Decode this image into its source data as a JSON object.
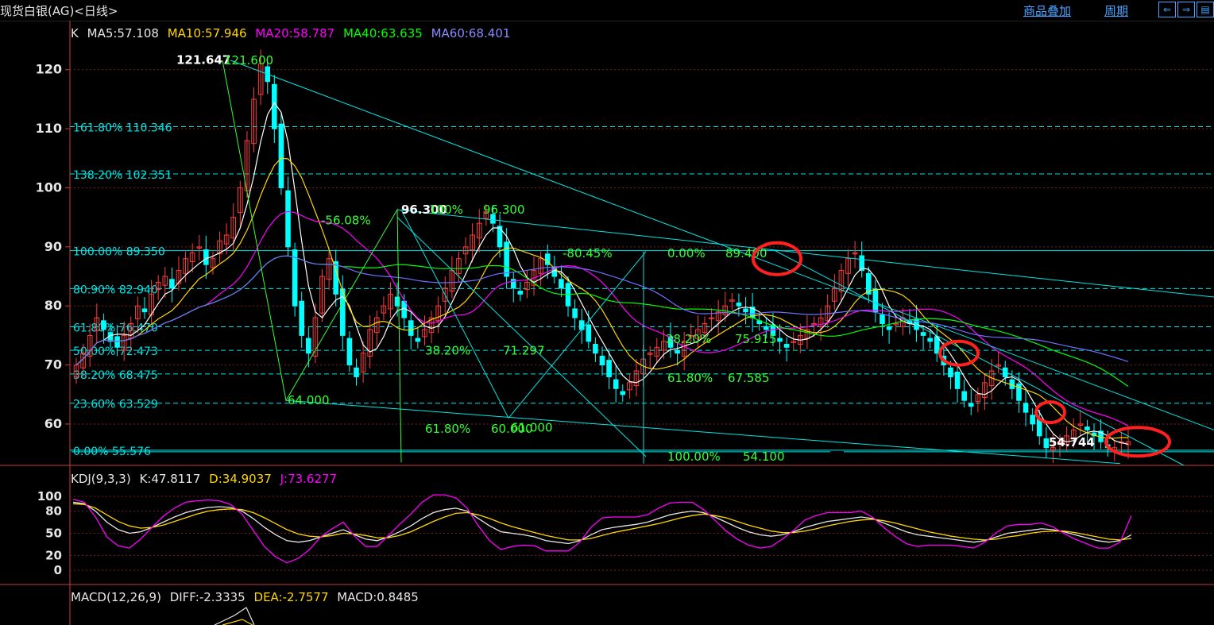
{
  "window": {
    "title": "现货白银(AG)<日线>",
    "links": [
      "商品叠加",
      "周期"
    ],
    "nav_icons": [
      "prev-icon",
      "next-icon",
      "menu-icon"
    ]
  },
  "colors": {
    "background": "#000000",
    "axis": "#c83c3c",
    "up_candle": "#ff3c3c",
    "down_candle": "#00ffff",
    "ma5": "#ffffff",
    "ma10": "#ffd700",
    "ma20": "#ff00ff",
    "ma40": "#00ff00",
    "ma60": "#6f6fff",
    "fib": "#00e5e5",
    "green_text": "#33ff33",
    "annotation_circle": "#ff2020"
  },
  "ma_legend": {
    "k": "K",
    "ma5": "MA5:57.108",
    "ma10": "MA10:57.946",
    "ma20": "MA20:58.787",
    "ma40": "MA40:63.635",
    "ma60": "MA60:68.401"
  },
  "kdj_legend": {
    "name": "KDJ(9,3,3)",
    "k": "K:47.8117",
    "d": "D:34.9037",
    "j": "J:73.6277"
  },
  "macd_legend": {
    "name": "MACD(12,26,9)",
    "diff": "DIFF:-2.3335",
    "dea": "DEA:-2.7577",
    "macd": "MACD:0.8485"
  },
  "chart_data": [
    {
      "type": "candlestick",
      "ylim": [
        53,
        124
      ],
      "y_ticks": [
        "120",
        "110",
        "100",
        "90",
        "80",
        "70",
        "60"
      ],
      "fib_levels": [
        {
          "label": "161.80% 110.346",
          "value": 110.346
        },
        {
          "label": "138.20% 102.351",
          "value": 102.351
        },
        {
          "label": "100.00% 89.350",
          "value": 89.35
        },
        {
          "label": "80.90% 82.940",
          "value": 82.94
        },
        {
          "label": "61.80% 76.470",
          "value": 76.47
        },
        {
          "label": "50.00% 72.473",
          "value": 72.473
        },
        {
          "label": "38.20% 68.475",
          "value": 68.475
        },
        {
          "label": "23.60% 63.529",
          "value": 63.529
        },
        {
          "label": "0.00% 55.576",
          "value": 55.576
        }
      ],
      "annotations": [
        {
          "text": "121.647",
          "value": 121.647
        },
        {
          "text": "121.600",
          "value": 121.6
        },
        {
          "text": "64.000",
          "value": 64.0
        },
        {
          "text": "-56.08%",
          "value": 94.5
        },
        {
          "text": "96.300",
          "value": 96.3
        },
        {
          "text": "100%",
          "value": 96.3
        },
        {
          "text": "96.300",
          "value": 96.3
        },
        {
          "text": "-80.45%",
          "value": 88.9
        },
        {
          "text": "0.00%",
          "value": 88.9
        },
        {
          "text": "89.400",
          "value": 88.9
        },
        {
          "text": "38.20%",
          "value": 72.4
        },
        {
          "text": "71.297",
          "value": 72.4
        },
        {
          "text": "38.20%",
          "value": 74.4
        },
        {
          "text": "75.915",
          "value": 74.4
        },
        {
          "text": "61.80%",
          "value": 67.8
        },
        {
          "text": "67.585",
          "value": 67.8
        },
        {
          "text": "61.80%",
          "value": 59.2
        },
        {
          "text": "60.000",
          "value": 59.2
        },
        {
          "text": "61.000",
          "value": 59.4
        },
        {
          "text": "100.00%",
          "value": 54.5
        },
        {
          "text": "54.100",
          "value": 54.5
        },
        {
          "text": "54.744",
          "value": 56.9
        }
      ],
      "closes": [
        70,
        72,
        75,
        78,
        76,
        74,
        73,
        75,
        77,
        80,
        79,
        82,
        84,
        85,
        83,
        86,
        88,
        89,
        90,
        87,
        88,
        91,
        92,
        95,
        100,
        108,
        115,
        121,
        118,
        110,
        100,
        90,
        80,
        75,
        72,
        78,
        85,
        88,
        82,
        75,
        70,
        68,
        72,
        76,
        78,
        80,
        82,
        80,
        78,
        75,
        74,
        76,
        78,
        80,
        83,
        86,
        88,
        90,
        92,
        94,
        96,
        94,
        90,
        85,
        83,
        82,
        84,
        86,
        88,
        87,
        85,
        83,
        80,
        78,
        76,
        74,
        72,
        70,
        68,
        66,
        65,
        67,
        69,
        71,
        72,
        73,
        74,
        73,
        72,
        74,
        75,
        76,
        77,
        78,
        79,
        80,
        81,
        80,
        79,
        78,
        77,
        76,
        75,
        74,
        73,
        74,
        75,
        76,
        77,
        78,
        80,
        83,
        86,
        88,
        89,
        86,
        82,
        79,
        77,
        76,
        77,
        78,
        77,
        76,
        75,
        74,
        72,
        70,
        68,
        66,
        64,
        63,
        65,
        67,
        69,
        70,
        68,
        66,
        64,
        62,
        60,
        58,
        56,
        56,
        57,
        58,
        59,
        60,
        59,
        58,
        57,
        56,
        56,
        57,
        57
      ]
    },
    {
      "type": "line",
      "ylim": [
        -5,
        110
      ],
      "y_ticks": [
        "100",
        "80",
        "50",
        "20",
        "0"
      ],
      "series": [
        {
          "name": "K",
          "values": [
            92,
            90,
            80,
            65,
            55,
            50,
            52,
            58,
            65,
            72,
            78,
            82,
            85,
            86,
            85,
            80,
            70,
            58,
            48,
            40,
            38,
            40,
            45,
            50,
            55,
            48,
            42,
            40,
            45,
            52,
            60,
            70,
            78,
            82,
            84,
            80,
            70,
            60,
            52,
            50,
            48,
            45,
            40,
            38,
            36,
            40,
            48,
            55,
            58,
            60,
            62,
            65,
            70,
            75,
            78,
            80,
            78,
            72,
            65,
            58,
            52,
            48,
            46,
            48,
            52,
            58,
            62,
            66,
            68,
            70,
            72,
            70,
            64,
            58,
            52,
            48,
            46,
            44,
            42,
            40,
            38,
            40,
            45,
            50,
            52,
            54,
            56,
            55,
            52,
            48,
            44,
            40,
            38,
            40,
            48
          ]
        },
        {
          "name": "D",
          "values": [
            90,
            89,
            84,
            75,
            66,
            60,
            57,
            58,
            61,
            66,
            71,
            76,
            80,
            82,
            83,
            82,
            78,
            71,
            63,
            55,
            49,
            46,
            45,
            47,
            50,
            49,
            47,
            44,
            44,
            47,
            52,
            59,
            66,
            72,
            77,
            78,
            75,
            70,
            64,
            59,
            55,
            51,
            47,
            44,
            41,
            41,
            43,
            47,
            51,
            54,
            57,
            60,
            63,
            67,
            71,
            74,
            76,
            74,
            71,
            66,
            61,
            57,
            53,
            51,
            51,
            53,
            56,
            60,
            63,
            66,
            68,
            69,
            67,
            64,
            60,
            56,
            52,
            49,
            46,
            44,
            42,
            41,
            42,
            45,
            47,
            50,
            52,
            53,
            53,
            51,
            48,
            45,
            42,
            41,
            43
          ]
        },
        {
          "name": "J",
          "values": [
            96,
            92,
            72,
            45,
            33,
            30,
            42,
            58,
            73,
            84,
            92,
            94,
            95,
            94,
            89,
            76,
            54,
            32,
            18,
            10,
            16,
            28,
            45,
            56,
            65,
            46,
            32,
            32,
            47,
            62,
            76,
            92,
            102,
            102,
            98,
            84,
            60,
            40,
            28,
            32,
            34,
            33,
            26,
            26,
            26,
            38,
            58,
            71,
            72,
            72,
            72,
            75,
            84,
            91,
            92,
            92,
            82,
            68,
            53,
            42,
            34,
            30,
            32,
            42,
            54,
            68,
            74,
            78,
            78,
            78,
            80,
            72,
            58,
            46,
            36,
            32,
            34,
            34,
            34,
            32,
            30,
            38,
            51,
            60,
            62,
            62,
            64,
            59,
            50,
            42,
            36,
            30,
            30,
            38,
            74
          ]
        }
      ]
    }
  ]
}
